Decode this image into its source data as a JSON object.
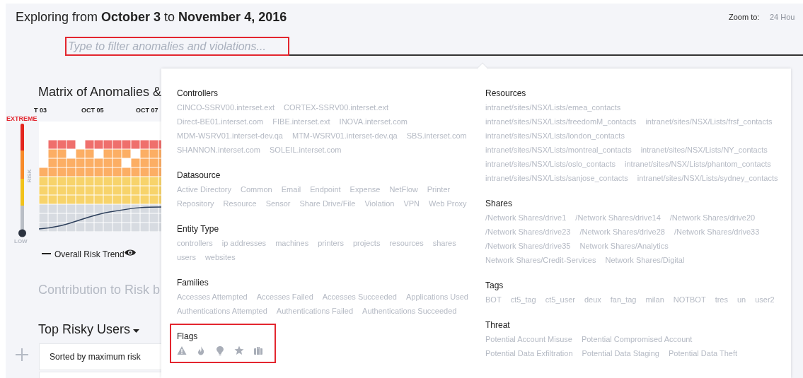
{
  "header": {
    "title": "Exploring from **October 3** to **November 4, 2016**",
    "zoom_label": "Zoom to:",
    "zoom_value": "24 Hou"
  },
  "filter": {
    "placeholder": "Type to filter anomalies and violations...",
    "highlighted": true
  },
  "matrix": {
    "title": "Matrix of Anomalies &",
    "date_labels": [
      "T 03",
      "OCT 05",
      "OCT 07"
    ],
    "scale_top": "EXTREME",
    "scale_axis": "RISK",
    "scale_bottom": "LOW",
    "legend": "Overall Risk Trend"
  },
  "contribution": {
    "title": "Contribution to Risk b"
  },
  "top_users": {
    "title": "Top Risky Users",
    "sort_label": "Sorted by maximum risk"
  },
  "filter_panel": {
    "columns": [
      [
        {
          "title": "Controllers",
          "kind": "list",
          "highlighted": false,
          "items": [
            "CINCO-SSRV00.interset.ext",
            "CORTEX-SSRV00.interset.ext",
            "Direct-BE01.interset.com",
            "FIBE.interset.ext",
            "INOVA.interset.com",
            "MDM-WSRV01.interset-dev.qa",
            "MTM-WSRV01.interset-dev.qa",
            "SBS.interset.com",
            "SHANNON.interset.com",
            "SOLEIL.interset.com"
          ]
        },
        {
          "title": "Datasource",
          "kind": "list",
          "highlighted": false,
          "items": [
            "Active Directory",
            "Common",
            "Email",
            "Endpoint",
            "Expense",
            "NetFlow",
            "Printer",
            "Repository",
            "Resource",
            "Sensor",
            "Share Drive/File",
            "Violation",
            "VPN",
            "Web Proxy"
          ]
        },
        {
          "title": "Entity Type",
          "kind": "list",
          "highlighted": false,
          "items": [
            "controllers",
            "ip addresses",
            "machines",
            "printers",
            "projects",
            "resources",
            "shares",
            "users",
            "websites"
          ]
        },
        {
          "title": "Families",
          "kind": "list",
          "highlighted": false,
          "items": [
            "Accesses Attempted",
            "Accesses Failed",
            "Accesses Succeeded",
            "Applications Used",
            "Authentications Attempted",
            "Authentications Failed",
            "Authentications Succeeded"
          ]
        },
        {
          "title": "Flags",
          "kind": "icons",
          "highlighted": true
        }
      ],
      [
        {
          "title": "Resources",
          "kind": "list",
          "highlighted": false,
          "items": [
            "intranet/sites/NSX/Lists/emea_contacts",
            "intranet/sites/NSX/Lists/freedomM_contacts",
            "intranet/sites/NSX/Lists/frsf_contacts",
            "intranet/sites/NSX/Lists/london_contacts",
            "intranet/sites/NSX/Lists/montreal_contacts",
            "intranet/sites/NSX/Lists/NY_contacts",
            "intranet/sites/NSX/Lists/oslo_contacts",
            "intranet/sites/NSX/Lists/phantom_contacts",
            "intranet/sites/NSX/Lists/sanjose_contacts",
            "intranet/sites/NSX/Lists/sydney_contacts"
          ]
        },
        {
          "title": "Shares",
          "kind": "list",
          "highlighted": false,
          "items": [
            "/Network Shares/drive1",
            "/Network Shares/drive14",
            "/Network Shares/drive20",
            "/Network Shares/drive23",
            "/Network Shares/drive28",
            "/Network Shares/drive33",
            "/Network Shares/drive35",
            "Network Shares/Analytics",
            "Network Shares/Credit-Services",
            "Network Shares/Digital"
          ]
        },
        {
          "title": "Tags",
          "kind": "list",
          "highlighted": false,
          "items": [
            "BOT",
            "ct5_tag",
            "ct5_user",
            "deux",
            "fan_tag",
            "milan",
            "NOTBOT",
            "tres",
            "un",
            "user2"
          ]
        },
        {
          "title": "Threat",
          "kind": "list",
          "highlighted": false,
          "items": [
            "Potential Account Misuse",
            "Potential Compromised Account",
            "Potential Data Exfiltration",
            "Potential Data Staging",
            "Potential Data Theft"
          ]
        }
      ]
    ]
  }
}
